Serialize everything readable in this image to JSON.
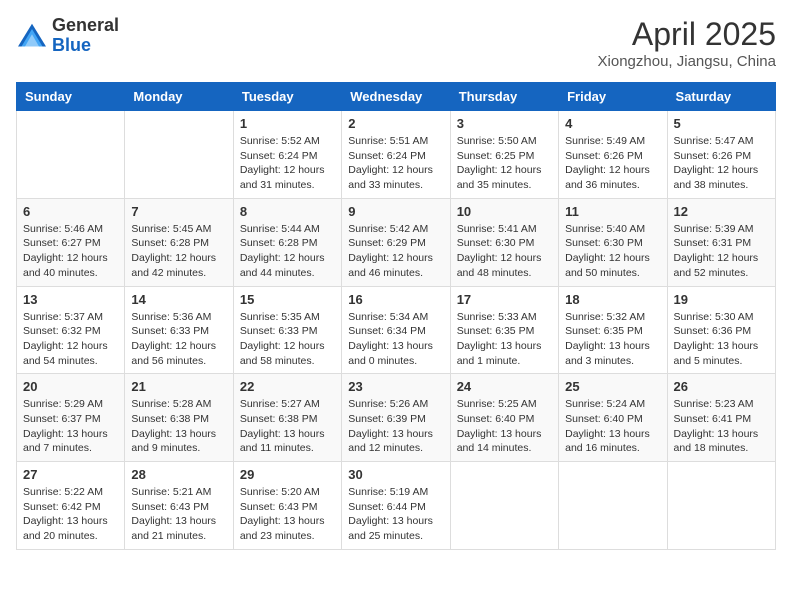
{
  "header": {
    "logo": {
      "general": "General",
      "blue": "Blue"
    },
    "title": "April 2025",
    "subtitle": "Xiongzhou, Jiangsu, China"
  },
  "calendar": {
    "days_of_week": [
      "Sunday",
      "Monday",
      "Tuesday",
      "Wednesday",
      "Thursday",
      "Friday",
      "Saturday"
    ],
    "weeks": [
      [
        {
          "day": "",
          "info": ""
        },
        {
          "day": "",
          "info": ""
        },
        {
          "day": "1",
          "info": "Sunrise: 5:52 AM\nSunset: 6:24 PM\nDaylight: 12 hours and 31 minutes."
        },
        {
          "day": "2",
          "info": "Sunrise: 5:51 AM\nSunset: 6:24 PM\nDaylight: 12 hours and 33 minutes."
        },
        {
          "day": "3",
          "info": "Sunrise: 5:50 AM\nSunset: 6:25 PM\nDaylight: 12 hours and 35 minutes."
        },
        {
          "day": "4",
          "info": "Sunrise: 5:49 AM\nSunset: 6:26 PM\nDaylight: 12 hours and 36 minutes."
        },
        {
          "day": "5",
          "info": "Sunrise: 5:47 AM\nSunset: 6:26 PM\nDaylight: 12 hours and 38 minutes."
        }
      ],
      [
        {
          "day": "6",
          "info": "Sunrise: 5:46 AM\nSunset: 6:27 PM\nDaylight: 12 hours and 40 minutes."
        },
        {
          "day": "7",
          "info": "Sunrise: 5:45 AM\nSunset: 6:28 PM\nDaylight: 12 hours and 42 minutes."
        },
        {
          "day": "8",
          "info": "Sunrise: 5:44 AM\nSunset: 6:28 PM\nDaylight: 12 hours and 44 minutes."
        },
        {
          "day": "9",
          "info": "Sunrise: 5:42 AM\nSunset: 6:29 PM\nDaylight: 12 hours and 46 minutes."
        },
        {
          "day": "10",
          "info": "Sunrise: 5:41 AM\nSunset: 6:30 PM\nDaylight: 12 hours and 48 minutes."
        },
        {
          "day": "11",
          "info": "Sunrise: 5:40 AM\nSunset: 6:30 PM\nDaylight: 12 hours and 50 minutes."
        },
        {
          "day": "12",
          "info": "Sunrise: 5:39 AM\nSunset: 6:31 PM\nDaylight: 12 hours and 52 minutes."
        }
      ],
      [
        {
          "day": "13",
          "info": "Sunrise: 5:37 AM\nSunset: 6:32 PM\nDaylight: 12 hours and 54 minutes."
        },
        {
          "day": "14",
          "info": "Sunrise: 5:36 AM\nSunset: 6:33 PM\nDaylight: 12 hours and 56 minutes."
        },
        {
          "day": "15",
          "info": "Sunrise: 5:35 AM\nSunset: 6:33 PM\nDaylight: 12 hours and 58 minutes."
        },
        {
          "day": "16",
          "info": "Sunrise: 5:34 AM\nSunset: 6:34 PM\nDaylight: 13 hours and 0 minutes."
        },
        {
          "day": "17",
          "info": "Sunrise: 5:33 AM\nSunset: 6:35 PM\nDaylight: 13 hours and 1 minute."
        },
        {
          "day": "18",
          "info": "Sunrise: 5:32 AM\nSunset: 6:35 PM\nDaylight: 13 hours and 3 minutes."
        },
        {
          "day": "19",
          "info": "Sunrise: 5:30 AM\nSunset: 6:36 PM\nDaylight: 13 hours and 5 minutes."
        }
      ],
      [
        {
          "day": "20",
          "info": "Sunrise: 5:29 AM\nSunset: 6:37 PM\nDaylight: 13 hours and 7 minutes."
        },
        {
          "day": "21",
          "info": "Sunrise: 5:28 AM\nSunset: 6:38 PM\nDaylight: 13 hours and 9 minutes."
        },
        {
          "day": "22",
          "info": "Sunrise: 5:27 AM\nSunset: 6:38 PM\nDaylight: 13 hours and 11 minutes."
        },
        {
          "day": "23",
          "info": "Sunrise: 5:26 AM\nSunset: 6:39 PM\nDaylight: 13 hours and 12 minutes."
        },
        {
          "day": "24",
          "info": "Sunrise: 5:25 AM\nSunset: 6:40 PM\nDaylight: 13 hours and 14 minutes."
        },
        {
          "day": "25",
          "info": "Sunrise: 5:24 AM\nSunset: 6:40 PM\nDaylight: 13 hours and 16 minutes."
        },
        {
          "day": "26",
          "info": "Sunrise: 5:23 AM\nSunset: 6:41 PM\nDaylight: 13 hours and 18 minutes."
        }
      ],
      [
        {
          "day": "27",
          "info": "Sunrise: 5:22 AM\nSunset: 6:42 PM\nDaylight: 13 hours and 20 minutes."
        },
        {
          "day": "28",
          "info": "Sunrise: 5:21 AM\nSunset: 6:43 PM\nDaylight: 13 hours and 21 minutes."
        },
        {
          "day": "29",
          "info": "Sunrise: 5:20 AM\nSunset: 6:43 PM\nDaylight: 13 hours and 23 minutes."
        },
        {
          "day": "30",
          "info": "Sunrise: 5:19 AM\nSunset: 6:44 PM\nDaylight: 13 hours and 25 minutes."
        },
        {
          "day": "",
          "info": ""
        },
        {
          "day": "",
          "info": ""
        },
        {
          "day": "",
          "info": ""
        }
      ]
    ]
  }
}
